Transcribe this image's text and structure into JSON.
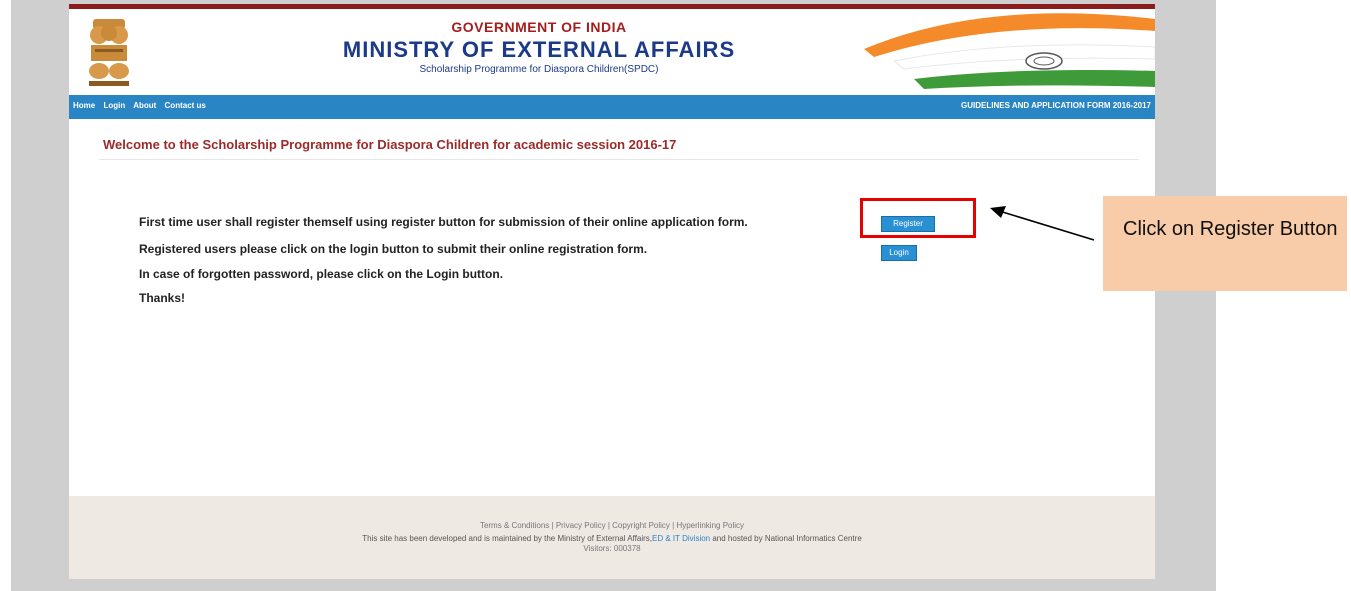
{
  "header": {
    "line1": "GOVERNMENT OF INDIA",
    "line2": "MINISTRY OF EXTERNAL AFFAIRS",
    "line3": "Scholarship Programme for Diaspora Children(SPDC)"
  },
  "nav": {
    "items": [
      {
        "label": "Home"
      },
      {
        "label": "Login"
      },
      {
        "label": "About"
      },
      {
        "label": "Contact us"
      }
    ],
    "right_label": "GUIDELINES AND APPLICATION FORM 2016-2017"
  },
  "main": {
    "welcome": "Welcome to the Scholarship Programme for Diaspora Children for academic session 2016-17",
    "line1": "First time user shall register themself using register button for submission of their online application form.",
    "line2": "Registered users please click on the login button to submit their online registration form.",
    "line3": "In case of forgotten password, please click on the Login button.",
    "line4": "Thanks!",
    "register_label": "Register",
    "login_label": "Login"
  },
  "footer": {
    "links": "Terms & Conditions | Privacy Policy | Copyright Policy | Hyperlinking Policy",
    "dev_prefix": "This site has been developed and is maintained by the Ministry of External Affairs,",
    "dev_division": "ED & IT Division",
    "dev_suffix": " and hosted by National Informatics Centre",
    "visitors": "Visitors: 000378"
  },
  "annotation": {
    "callout": "Click on Register Button",
    "highlight_color": "#e60000",
    "callout_bg": "#f8cba9"
  },
  "colors": {
    "nav": "#2a85c5",
    "title_red": "#a31e1e",
    "title_blue": "#1c3a8a",
    "welcome": "#9b2b2b"
  }
}
